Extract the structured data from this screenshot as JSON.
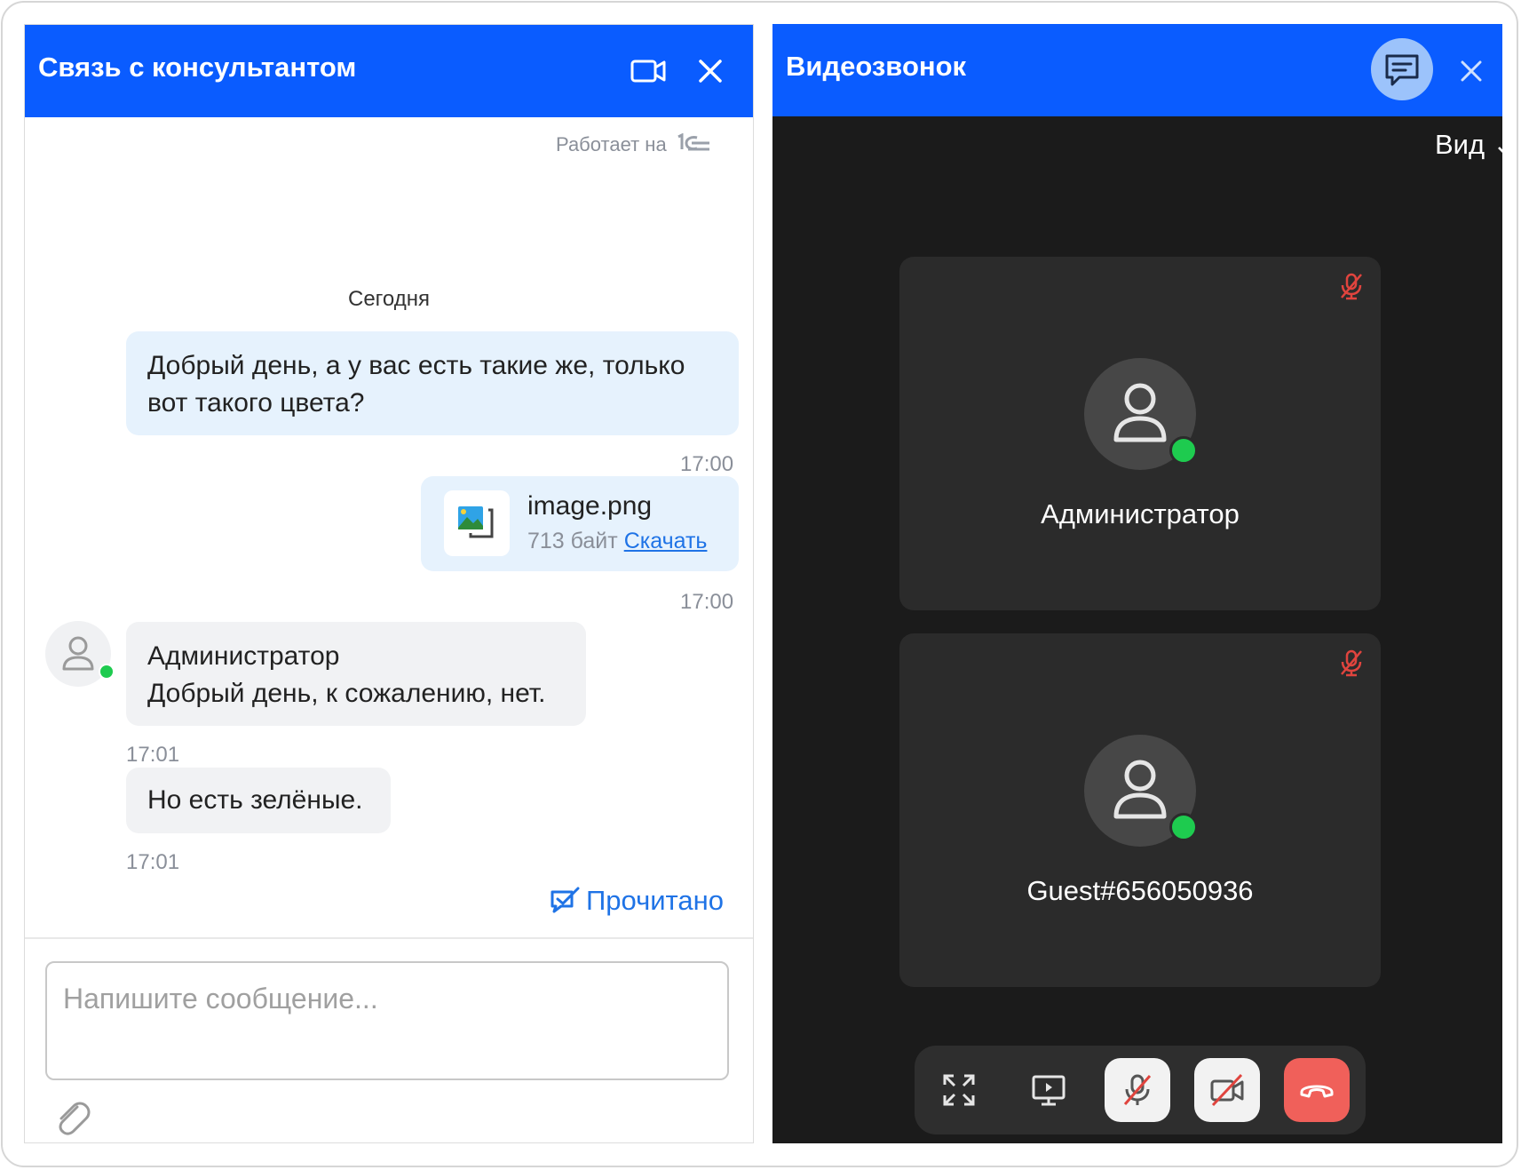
{
  "chat_widget": {
    "title": "Связь с консультантом",
    "powered_by": "Работает на",
    "date_separator": "Сегодня",
    "messages": [
      {
        "text": "Добрый день, а у вас есть такие же, только вот такого цвета?",
        "time": "17:00"
      },
      {
        "file_name": "image.png",
        "file_size": "713 байт",
        "download_label": "Скачать",
        "time": "17:00"
      },
      {
        "author": "Администратор",
        "text": "Добрый день, к сожалению, нет.",
        "time": "17:01"
      },
      {
        "text": "Но есть зелёные.",
        "time": "17:01"
      }
    ],
    "read_status": "Прочитано",
    "input_placeholder": "Напишите сообщение..."
  },
  "video_call": {
    "title": "Видеозвонок",
    "view_label": "Вид",
    "participants": [
      {
        "name": "Администратор",
        "online": true,
        "muted": true
      },
      {
        "name": "Guest#656050936",
        "online": true,
        "muted": true
      }
    ],
    "controls": [
      "fullscreen-icon",
      "screen-share-icon",
      "mic-off-icon",
      "camera-off-icon",
      "hang-up-icon"
    ]
  },
  "colors": {
    "header_blue": "#0a5cff",
    "link_blue": "#1f73e6",
    "outgoing_bubble": "#e6f2fd",
    "incoming_bubble": "#f1f2f4",
    "online_green": "#1ecb4f",
    "hangup_red": "#f0605a",
    "video_bg": "#1b1b1b",
    "tile_bg": "#2b2b2b"
  }
}
